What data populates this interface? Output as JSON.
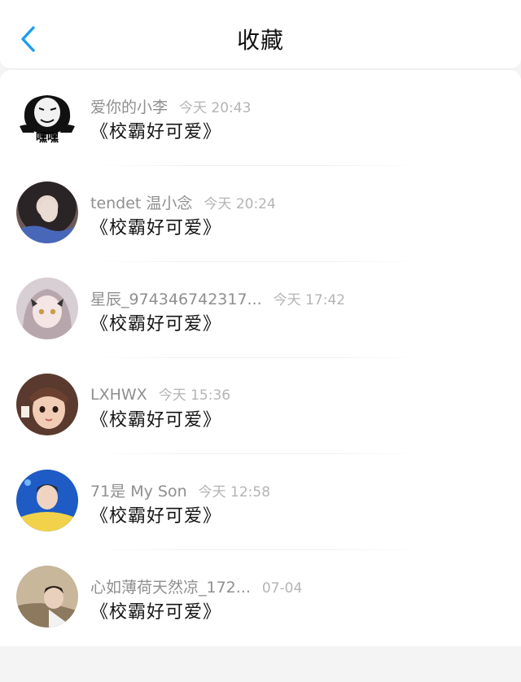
{
  "header": {
    "title": "收藏",
    "back_icon": "chevron-left-icon",
    "accent": "#1a9ff0"
  },
  "items": [
    {
      "name": "爱你的小李",
      "time": "今天 20:43",
      "message": "《校霸好可爱》",
      "avatar": "meme-face-avatar",
      "avatar_caption": "嘿嘿"
    },
    {
      "name": "tendet 温小念",
      "time": "今天 20:24",
      "message": "《校霸好可爱》",
      "avatar": "girl-photo-avatar"
    },
    {
      "name": "星辰_974346742317...",
      "time": "今天 17:42",
      "message": "《校霸好可爱》",
      "avatar": "anime-girl-avatar"
    },
    {
      "name": "LXHWX",
      "time": "今天 15:36",
      "message": "《校霸好可爱》",
      "avatar": "cartoon-girl-avatar"
    },
    {
      "name": "71是 My Son",
      "time": "今天 12:58",
      "message": "《校霸好可爱》",
      "avatar": "boy-blue-avatar"
    },
    {
      "name": "心如薄荷天然凉_172...",
      "time": "07-04",
      "message": "《校霸好可爱》",
      "avatar": "boy-photo-avatar"
    }
  ]
}
